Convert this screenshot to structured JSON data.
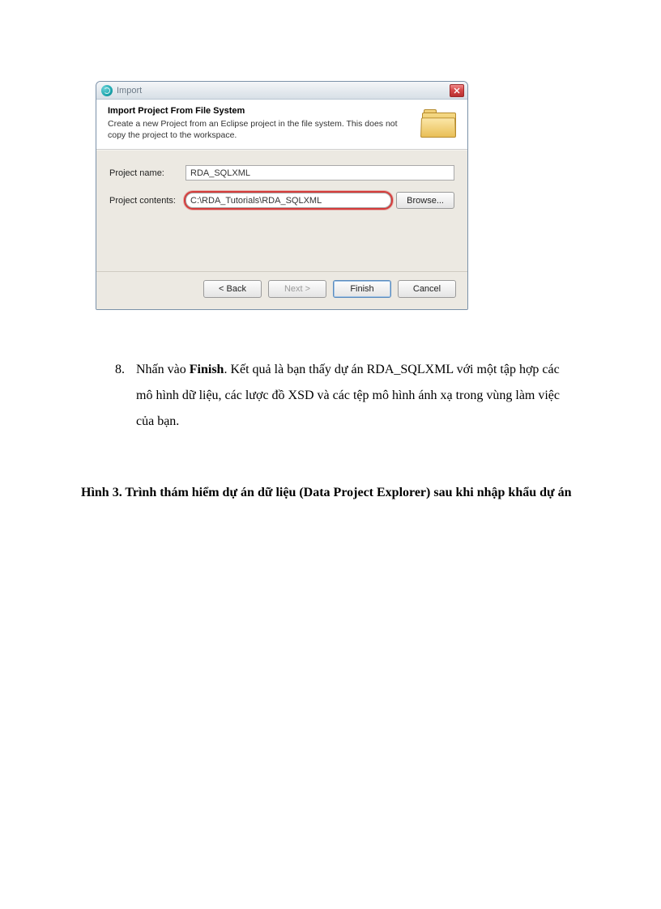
{
  "dialog": {
    "window_title": "Import",
    "banner_title": "Import Project From File System",
    "banner_desc": "Create a new Project from an Eclipse project in the file system. This does not copy the project to the workspace.",
    "project_name_label": "Project name:",
    "project_name_value": "RDA_SQLXML",
    "project_contents_label": "Project contents:",
    "project_contents_value": "C:\\RDA_Tutorials\\RDA_SQLXML",
    "browse_label": "Browse...",
    "buttons": {
      "back": "< Back",
      "next": "Next >",
      "finish": "Finish",
      "cancel": "Cancel"
    }
  },
  "body": {
    "list_number": "8.",
    "list_pre": "Nhấn vào ",
    "list_bold": "Finish",
    "list_post": ". Kết quả là bạn thấy dự án RDA_SQLXML với một tập hợp các mô hình dữ liệu, các lược đồ XSD và các tệp mô hình ánh xạ trong vùng làm việc của bạn.",
    "caption": "Hình 3. Trình thám hiểm dự án dữ liệu (Data Project Explorer) sau khi nhập khẩu dự án"
  }
}
